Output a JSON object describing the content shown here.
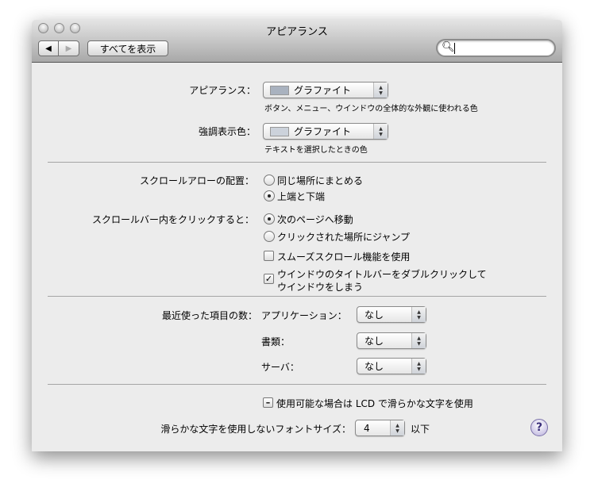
{
  "window": {
    "title": "アピアランス"
  },
  "toolbar": {
    "back": "◀",
    "forward": "▶",
    "show_all": "すべてを表示",
    "search_placeholder": ""
  },
  "appearance": {
    "label": "アピアランス：",
    "value": "グラファイト",
    "swatch": "#a9b2bf",
    "desc": "ボタン、メニュー、ウインドウの全体的な外観に使われる色"
  },
  "highlight": {
    "label": "強調表示色：",
    "value": "グラファイト",
    "swatch": "#ccd2db",
    "desc": "テキストを選択したときの色"
  },
  "scroll_arrows": {
    "label": "スクロールアローの配置：",
    "options": [
      "同じ場所にまとめる",
      "上端と下端"
    ],
    "selected": 1
  },
  "scroll_click": {
    "label": "スクロールバー内をクリックすると：",
    "options": [
      "次のページへ移動",
      "クリックされた場所にジャンプ"
    ],
    "selected": 0
  },
  "smooth_scroll": {
    "label": "スムーズスクロール機能を使用",
    "checked": false
  },
  "double_click": {
    "line1": "ウインドウのタイトルバーをダブルクリックして",
    "line2": "ウインドウをしまう",
    "checked": true
  },
  "recent": {
    "label": "最近使った項目の数：",
    "apps_label": "アプリケーション：",
    "apps": "なし",
    "docs_label": "書類：",
    "docs": "なし",
    "servers_label": "サーバ：",
    "servers": "なし"
  },
  "lcd": {
    "label": "使用可能な場合は LCD で滑らかな文字を使用",
    "state": "mixed"
  },
  "font_size": {
    "label": "滑らかな文字を使用しないフォントサイズ：",
    "value": "4",
    "suffix": "以下"
  },
  "help": "?"
}
